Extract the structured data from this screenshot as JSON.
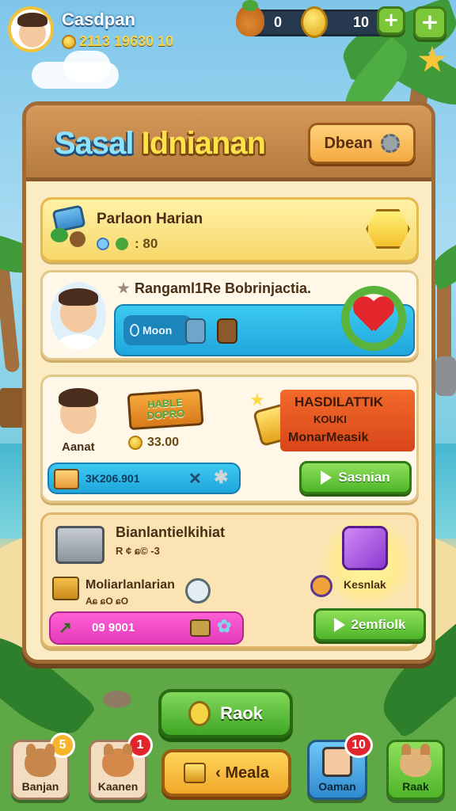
{
  "player": {
    "name": "Casdpan",
    "stats": "2113 19630 10"
  },
  "resources": {
    "fruit_count": "0",
    "coin_count": "10"
  },
  "panel": {
    "title_part1": "Sasal",
    "title_part2": "Idnianan",
    "header_button": "Dbean"
  },
  "cards": [
    {
      "title": "Parlaon Harian",
      "stat": ": 80"
    },
    {
      "title": "Rangaml1Re Bobrinjactia.",
      "bar_label": "Moon"
    },
    {
      "name": "Aanat",
      "sign_text": "HABLE DOPRO",
      "price": "33.00",
      "banner_line1": "HASDILATTIK",
      "banner_line2": "KOUKI",
      "banner_line3": "MonarMeasik",
      "bar_value": "3K206.901",
      "button_label": "Sasnian"
    },
    {
      "title": "Bianlantielkihiat",
      "subtitle": "R ¢ ɕ© -3",
      "item_title": "Moliarlanlarian",
      "item_sub": "Aɕ ɕO ɕO",
      "bar_value": "09 9001",
      "reward_label": "Kesnlak",
      "button_label": "2emfiolk"
    }
  ],
  "bottom": {
    "rank_button": "Raok",
    "middle_button": "Meala",
    "nav": [
      {
        "label": "Banjan",
        "badge": "5"
      },
      {
        "label": "Kaanen",
        "badge": "1"
      },
      {
        "label": "Oaman",
        "badge": "10"
      },
      {
        "label": "Raak",
        "badge": ""
      }
    ]
  },
  "colors": {
    "panel_bg": "#fbecc4",
    "wood": "#b57a3e",
    "green": "#4fb52a",
    "blue_bar": "#20a6dc",
    "pink_bar": "#e43cba"
  }
}
